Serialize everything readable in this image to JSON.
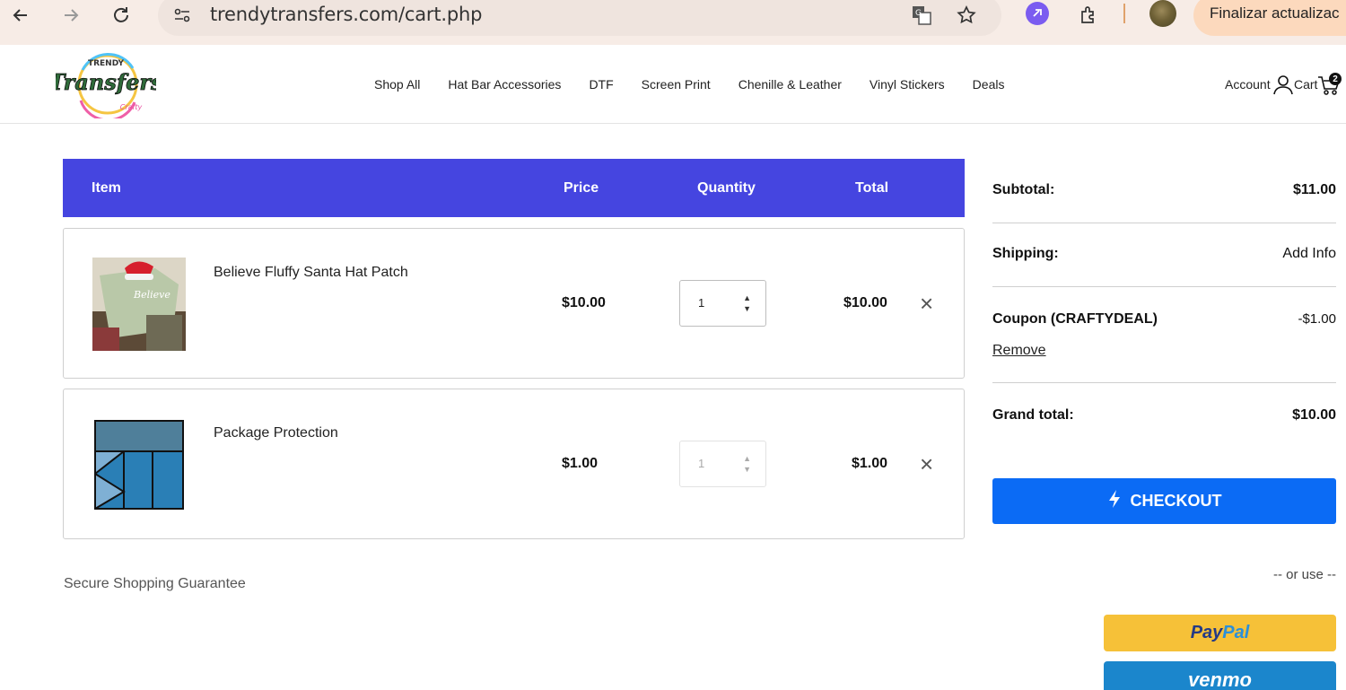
{
  "browser": {
    "url": "trendytransfers.com/cart.php",
    "update_button": "Finalizar actualizac"
  },
  "header": {
    "logo_text": "Trendy Transfers",
    "nav": [
      "Shop All",
      "Hat Bar Accessories",
      "DTF",
      "Screen Print",
      "Chenille & Leather",
      "Vinyl Stickers",
      "Deals"
    ],
    "account_label": "Account",
    "cart_label": "Cart",
    "cart_count": "2"
  },
  "cart": {
    "columns": {
      "item": "Item",
      "price": "Price",
      "quantity": "Quantity",
      "total": "Total"
    },
    "items": [
      {
        "name": "Believe Fluffy Santa Hat Patch",
        "price": "$10.00",
        "quantity": "1",
        "total": "$10.00"
      },
      {
        "name": "Package Protection",
        "price": "$1.00",
        "quantity": "1",
        "total": "$1.00"
      }
    ],
    "remove_glyph": "×",
    "secure_text": "Secure Shopping Guarantee"
  },
  "summary": {
    "subtotal_label": "Subtotal:",
    "subtotal_value": "$11.00",
    "shipping_label": "Shipping:",
    "shipping_value": "Add Info",
    "coupon_label": "Coupon (CRAFTYDEAL)",
    "coupon_value": "-$1.00",
    "remove_label": "Remove",
    "grand_total_label": "Grand total:",
    "grand_total_value": "$10.00",
    "checkout_label": "CHECKOUT",
    "or_use": "-- or use --",
    "paypal_a": "Pay",
    "paypal_b": "Pal",
    "venmo": "venmo"
  },
  "colors": {
    "table_header": "#4545e0",
    "checkout": "#0b6bf5",
    "paypal": "#f6c138",
    "venmo": "#1b86cc"
  }
}
